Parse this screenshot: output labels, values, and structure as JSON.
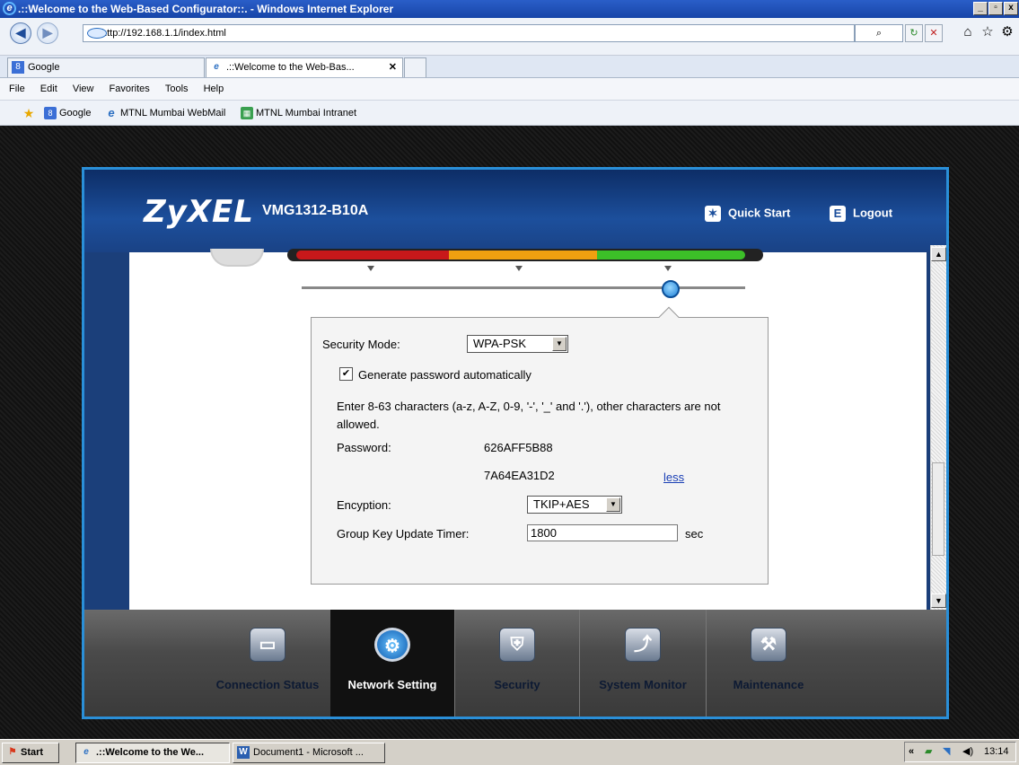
{
  "window": {
    "title": ".::Welcome to the Web-Based Configurator::. - Windows Internet Explorer",
    "minimize": "_",
    "maximize": "▫",
    "close": "x"
  },
  "browser": {
    "address": "http://192.168.1.1/index.html",
    "back": "◀",
    "forward": "▶",
    "search_icon": "⌕",
    "refresh": "↻",
    "stop": "✕",
    "home": "⌂",
    "favorites": "☆",
    "tools": "⚙",
    "tabs": [
      {
        "label": "Google"
      },
      {
        "label": ".::Welcome to the Web-Bas...",
        "close": "✕"
      }
    ],
    "menu": [
      "File",
      "Edit",
      "View",
      "Favorites",
      "Tools",
      "Help"
    ],
    "favorites_bar": [
      "Google",
      "MTNL Mumbai WebMail",
      "MTNL Mumbai Intranet"
    ]
  },
  "router": {
    "brand": "ZyXEL",
    "model": "VMG1312-B10A",
    "quick_start": "Quick Start",
    "logout": "Logout",
    "form": {
      "security_mode_label": "Security Mode:",
      "security_mode_value": "WPA-PSK",
      "generate_password_label": "Generate password automatically",
      "generate_password_checked": "✔",
      "hint": "Enter 8-63 characters (a-z, A-Z, 0-9, '-', '_' and '.'), other characters are not allowed.",
      "password_label": "Password:",
      "password_line1": "626AFF5B88",
      "password_line2": "7A64EA31D2",
      "less_link": "less",
      "encryption_label": "Encyption:",
      "encryption_value": "TKIP+AES",
      "group_key_label": "Group Key Update Timer:",
      "group_key_value": "1800",
      "group_key_unit": "sec"
    },
    "nav": [
      {
        "label": "Connection Status",
        "icon": "monitor-icon"
      },
      {
        "label": "Network Setting",
        "icon": "gear-icon",
        "active": true
      },
      {
        "label": "Security",
        "icon": "shield-icon"
      },
      {
        "label": "System Monitor",
        "icon": "chart-icon"
      },
      {
        "label": "Maintenance",
        "icon": "tools-icon"
      }
    ]
  },
  "taskbar": {
    "start": "Start",
    "items": [
      ".::Welcome to the We...",
      "Document1 - Microsoft ..."
    ],
    "tray_chevron": "«",
    "clock": "13:14"
  },
  "colors": {
    "band_red": "#c8181a",
    "band_orange": "#f0a010",
    "band_green": "#3cbf28",
    "header_blue": "#1c4f9c",
    "frame_blue": "#2a8fd8"
  }
}
